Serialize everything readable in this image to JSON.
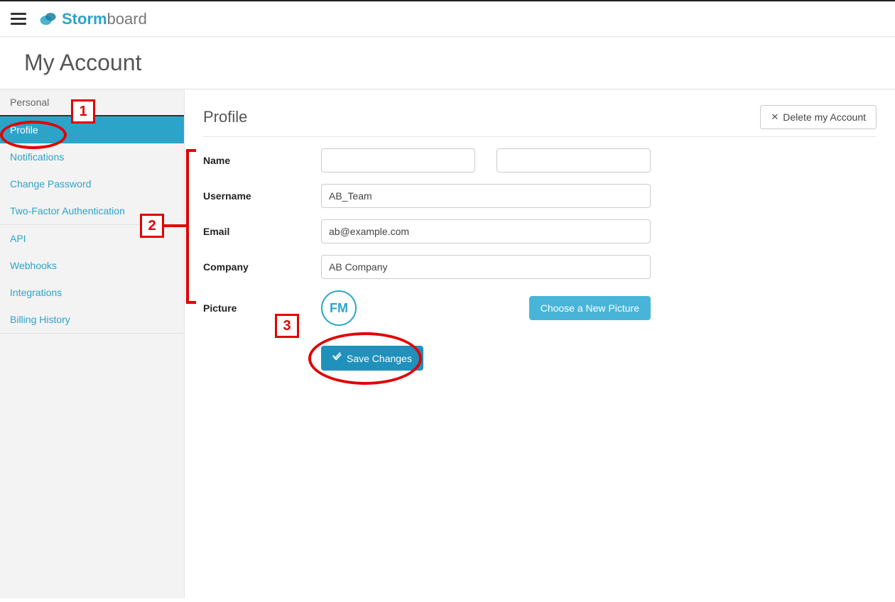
{
  "logo": {
    "word1": "Storm",
    "word2": "board"
  },
  "page_title": "My Account",
  "sidebar": {
    "section_label": "Personal",
    "items_group1": [
      {
        "label": "Profile",
        "active": true
      },
      {
        "label": "Notifications",
        "active": false
      },
      {
        "label": "Change Password",
        "active": false
      },
      {
        "label": "Two-Factor Authentication",
        "active": false
      }
    ],
    "items_group2": [
      {
        "label": "API"
      },
      {
        "label": "Webhooks"
      },
      {
        "label": "Integrations"
      },
      {
        "label": "Billing History"
      }
    ]
  },
  "main": {
    "heading": "Profile",
    "delete_label": "Delete my Account",
    "fields": {
      "name_label": "Name",
      "first_name": "",
      "last_name": "",
      "username_label": "Username",
      "username": "AB_Team",
      "email_label": "Email",
      "email": "ab@example.com",
      "company_label": "Company",
      "company": "AB Company",
      "picture_label": "Picture",
      "avatar_initials": "FM",
      "choose_picture_label": "Choose a New Picture",
      "save_label": "Save Changes"
    }
  },
  "annotations": {
    "n1": "1",
    "n2": "2",
    "n3": "3"
  }
}
